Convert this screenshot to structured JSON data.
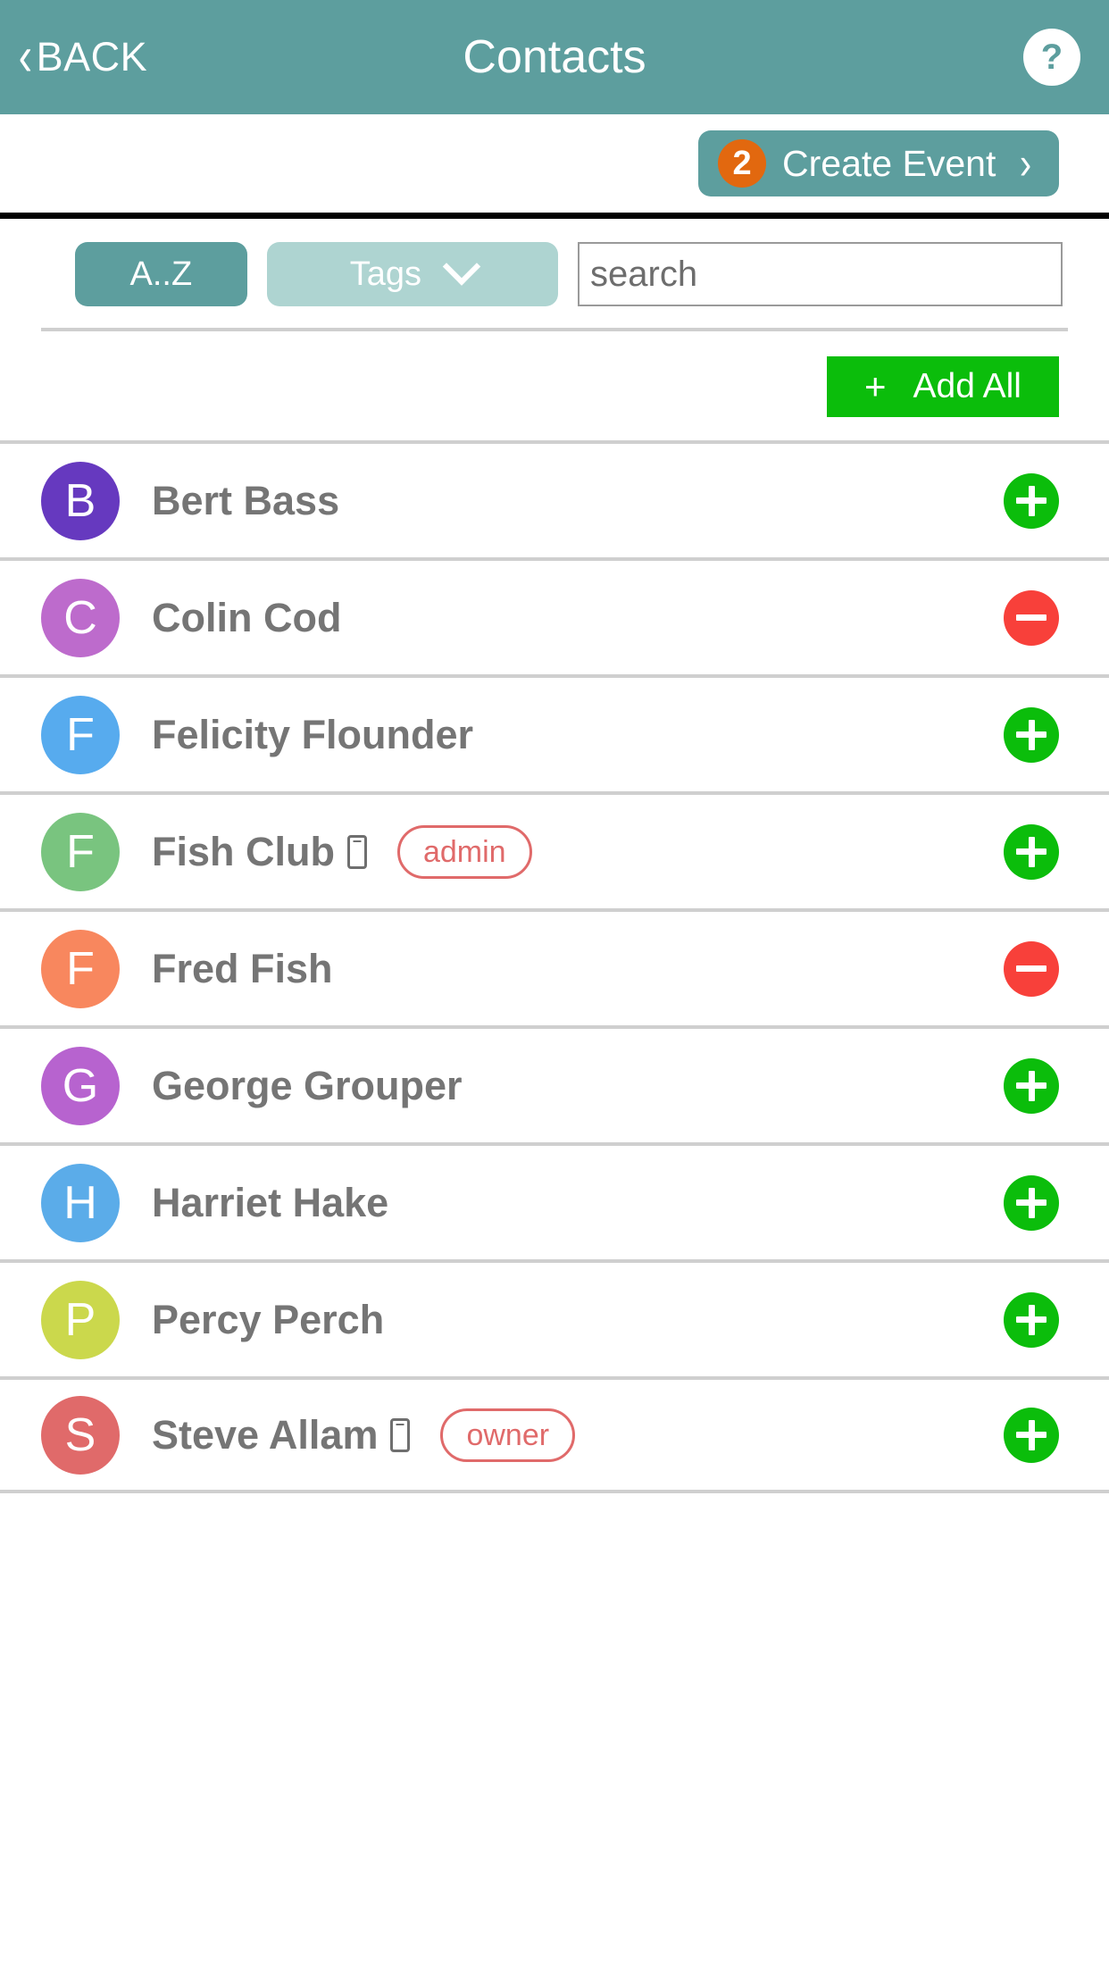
{
  "header": {
    "back_label": "BACK",
    "title": "Contacts",
    "help_label": "?"
  },
  "create_event": {
    "count": "2",
    "label": "Create Event",
    "chevron": "›"
  },
  "filters": {
    "az_label": "A..Z",
    "tags_label": "Tags",
    "search_placeholder": "search",
    "search_value": ""
  },
  "add_all": {
    "plus": "+",
    "label": "Add All"
  },
  "contacts": [
    {
      "initial": "B",
      "name": "Bert Bass",
      "color": "#6639bf",
      "phone": false,
      "role": "",
      "action": "add"
    },
    {
      "initial": "C",
      "name": "Colin Cod",
      "color": "#bd6bcc",
      "phone": false,
      "role": "",
      "action": "remove"
    },
    {
      "initial": "F",
      "name": "Felicity Flounder",
      "color": "#57abee",
      "phone": false,
      "role": "",
      "action": "add"
    },
    {
      "initial": "F",
      "name": "Fish Club",
      "color": "#79c47f",
      "phone": true,
      "role": "admin",
      "action": "add"
    },
    {
      "initial": "F",
      "name": "Fred Fish",
      "color": "#f8875e",
      "phone": false,
      "role": "",
      "action": "remove"
    },
    {
      "initial": "G",
      "name": "George Grouper",
      "color": "#b763cf",
      "phone": false,
      "role": "",
      "action": "add"
    },
    {
      "initial": "H",
      "name": "Harriet Hake",
      "color": "#5bace9",
      "phone": false,
      "role": "",
      "action": "add"
    },
    {
      "initial": "P",
      "name": "Percy Perch",
      "color": "#cbd84c",
      "phone": false,
      "role": "",
      "action": "add"
    },
    {
      "initial": "S",
      "name": "Steve Allam",
      "color": "#e06a6a",
      "phone": true,
      "role": "owner",
      "action": "add"
    }
  ],
  "colors": {
    "header_teal": "#5d9e9e",
    "tags_teal": "#aed4d1",
    "badge_orange": "#e2680f",
    "green": "#0bbd0b",
    "red": "#f8403a",
    "role_red": "#e06a6a"
  }
}
